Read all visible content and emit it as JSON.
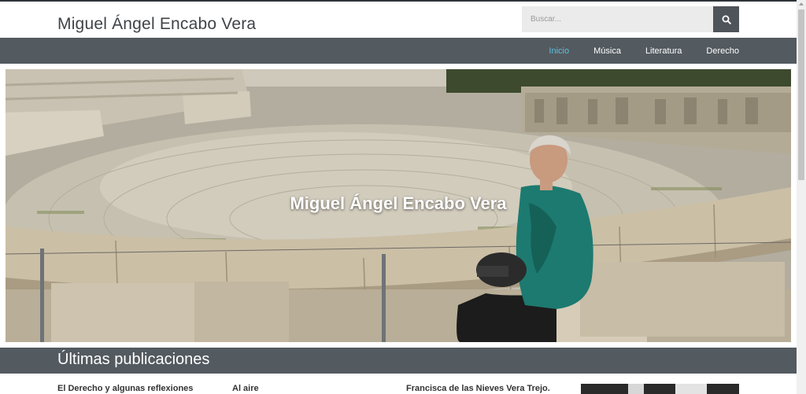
{
  "header": {
    "site_title": "Miguel Ángel Encabo Vera",
    "search": {
      "placeholder": "Buscar..."
    }
  },
  "nav": {
    "items": [
      {
        "label": "Inicio",
        "active": true
      },
      {
        "label": "Música",
        "active": false
      },
      {
        "label": "Literatura",
        "active": false
      },
      {
        "label": "Derecho",
        "active": false
      }
    ]
  },
  "hero": {
    "title": "Miguel Ángel Encabo Vera"
  },
  "section": {
    "title": "Últimas publicaciones"
  },
  "posts": [
    {
      "title": "El Derecho y algunas reflexiones"
    },
    {
      "title": "Al aire"
    },
    {
      "title": "Francisca de las Nieves Vera Trejo."
    }
  ],
  "colors": {
    "navbar_bg": "#535a60",
    "nav_active": "#5bc0de",
    "search_bg": "#ebebeb",
    "search_button_bg": "#4e5459"
  }
}
